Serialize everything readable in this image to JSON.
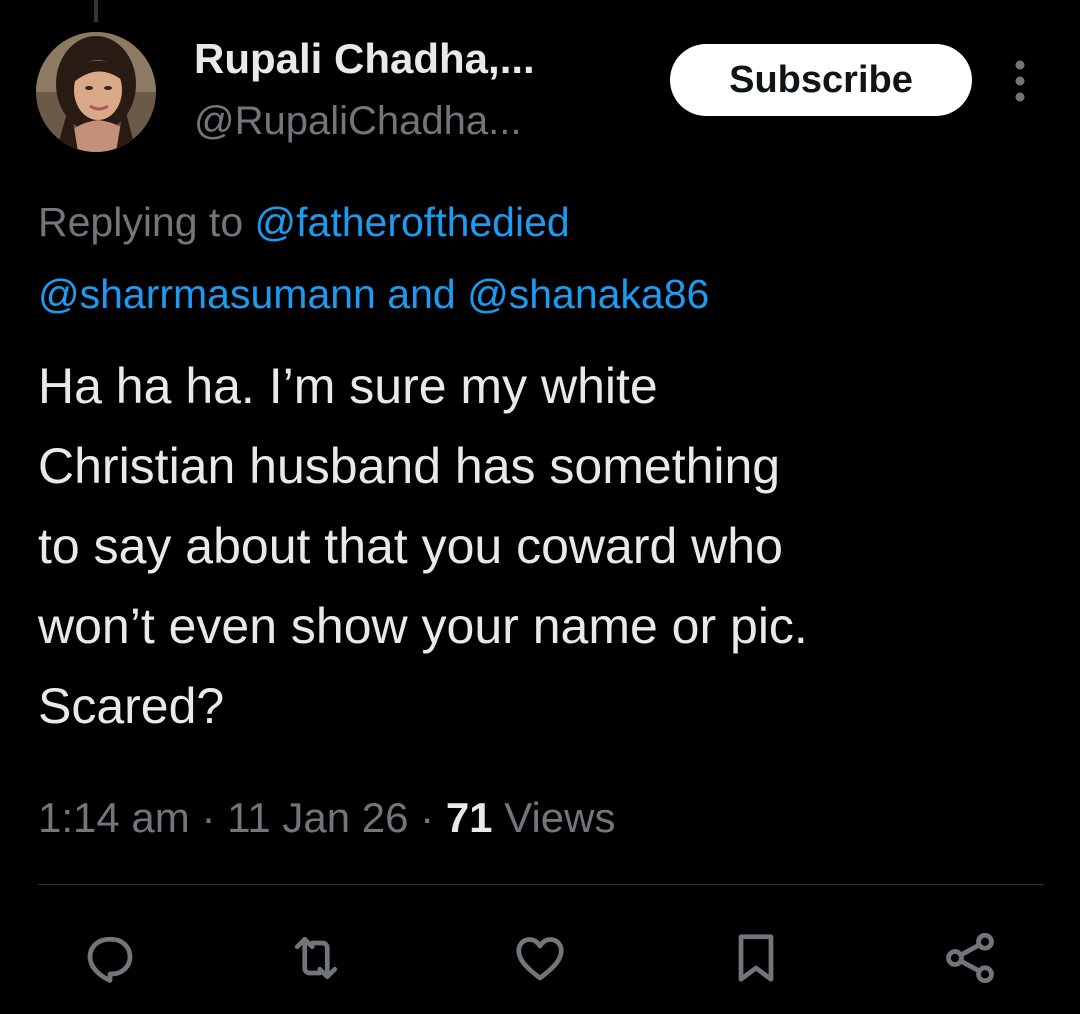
{
  "author": {
    "name": "Rupali Chadha,...",
    "handle": "@RupaliChadha...",
    "avatar": "profile-photo"
  },
  "header": {
    "subscribe_label": "Subscribe",
    "more_icon": "more-vertical-icon"
  },
  "reply_context": {
    "prefix": "Replying to",
    "mention_1": "@fatherofthedied",
    "mention_2": "@sharrmasumann",
    "joiner": "and",
    "mention_3": "@shanaka86"
  },
  "tweet": {
    "lines": [
      "Ha ha ha. I’m sure my white",
      "Christian husband has something",
      "to say about that you coward who",
      "won’t even show your name or pic.",
      "Scared?"
    ]
  },
  "meta": {
    "time": "1:14 am",
    "date": "11 Jan 26",
    "views_count": "71",
    "views_label": "Views",
    "separator": "·"
  },
  "actions": [
    {
      "icon": "reply-icon"
    },
    {
      "icon": "retweet-icon"
    },
    {
      "icon": "like-icon"
    },
    {
      "icon": "bookmark-icon"
    },
    {
      "icon": "share-icon"
    }
  ],
  "colors": {
    "background": "#000000",
    "text_primary": "#e7e9ea",
    "text_secondary": "#71767b",
    "link": "#1d9bf0",
    "divider": "#2f3336",
    "button_bg": "#ffffff"
  }
}
